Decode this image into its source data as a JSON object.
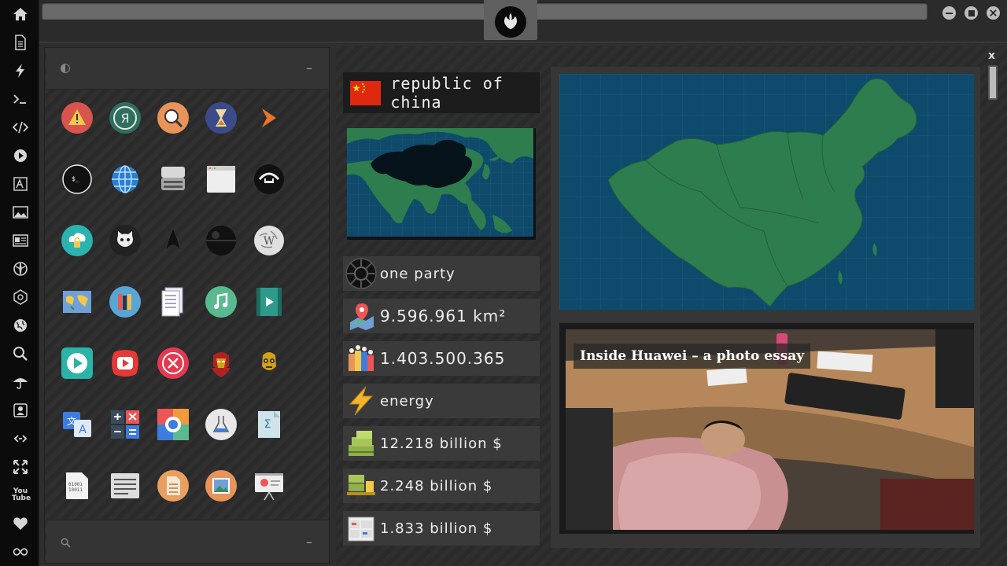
{
  "dock": {
    "items": [
      "home-icon",
      "document-icon",
      "bolt-icon",
      "terminal-icon",
      "code-icon",
      "play-icon",
      "translate-icon",
      "image-icon",
      "news-icon",
      "rebel-icon",
      "empire-icon",
      "globe-icon",
      "search-icon",
      "umbrella-icon",
      "contact-icon",
      "link-icon",
      "expand-icon",
      "youtube-icon",
      "heart-icon",
      "infinity-icon"
    ],
    "youtube_label": "You Tube"
  },
  "topbar": {
    "window_buttons": [
      "minimize",
      "maximize",
      "close"
    ]
  },
  "launcher": {
    "minimize_label": "–",
    "search_minimize_label": "–",
    "apps": [
      {
        "name": "warning",
        "color": "#d9534f"
      },
      {
        "name": "yandex",
        "color": "#2f6f5e"
      },
      {
        "name": "search",
        "color": "#e8935a"
      },
      {
        "name": "hourglass",
        "color": "#3b4a8a"
      },
      {
        "name": "arrow",
        "color": "#e8742a"
      },
      {
        "name": "terminal",
        "color": "#111111"
      },
      {
        "name": "globe",
        "color": "#2a7fd1"
      },
      {
        "name": "scanner",
        "color": "#cccccc"
      },
      {
        "name": "window",
        "color": "#eeeeee"
      },
      {
        "name": "ubuntu-cloud",
        "color": "#111111"
      },
      {
        "name": "cloud-lock",
        "color": "#2bb3b0"
      },
      {
        "name": "github",
        "color": "#222222"
      },
      {
        "name": "starfleet",
        "color": "#111111"
      },
      {
        "name": "death-star",
        "color": "#111111"
      },
      {
        "name": "wikipedia",
        "color": "#dddddd"
      },
      {
        "name": "world-map",
        "color": "#6fa0d8"
      },
      {
        "name": "books",
        "color": "#58a6d4"
      },
      {
        "name": "document-stack",
        "color": "#aab4c8"
      },
      {
        "name": "music",
        "color": "#59b98f"
      },
      {
        "name": "video",
        "color": "#2d9a8a"
      },
      {
        "name": "play-store",
        "color": "#2bb3a6"
      },
      {
        "name": "youtube",
        "color": "#e53935"
      },
      {
        "name": "cancel",
        "color": "#e53950"
      },
      {
        "name": "iron-man",
        "color": "#b22222"
      },
      {
        "name": "c3po",
        "color": "#d4a017"
      },
      {
        "name": "translate",
        "color": "#3d7de0"
      },
      {
        "name": "calculator",
        "color": "#3a4a5a"
      },
      {
        "name": "photo-viewer",
        "color": "#f29a3a"
      },
      {
        "name": "science",
        "color": "#e8e8e8"
      },
      {
        "name": "math-doc",
        "color": "#cfe3ea"
      },
      {
        "name": "binary-file",
        "color": "#f2f2f2"
      },
      {
        "name": "text-editor",
        "color": "#dddddd"
      },
      {
        "name": "document",
        "color": "#e8a060"
      },
      {
        "name": "image",
        "color": "#e8935a"
      },
      {
        "name": "presentation",
        "color": "#eeeeee"
      }
    ]
  },
  "info": {
    "close_label": "x",
    "country": "republic of china",
    "stats": [
      {
        "icon": "empire-icon",
        "text": "one party"
      },
      {
        "icon": "map-pin-icon",
        "text": "9.596.961 km²"
      },
      {
        "icon": "population-icon",
        "text": "1.403.500.365"
      },
      {
        "icon": "energy-icon",
        "text": "energy"
      },
      {
        "icon": "money-icon",
        "text": "12.218 billion $"
      },
      {
        "icon": "forklift-icon",
        "text": "2.248 billion $"
      },
      {
        "icon": "cargo-icon",
        "text": "1.833 billion $"
      }
    ],
    "photo_caption": "Inside Huawei – a photo essay"
  },
  "colors": {
    "dock_bg": "#0b0b0b",
    "map_sea": "#0e4a6b",
    "map_land": "#2e7d4f",
    "flag_red": "#de2910",
    "flag_star": "#ffde00"
  }
}
